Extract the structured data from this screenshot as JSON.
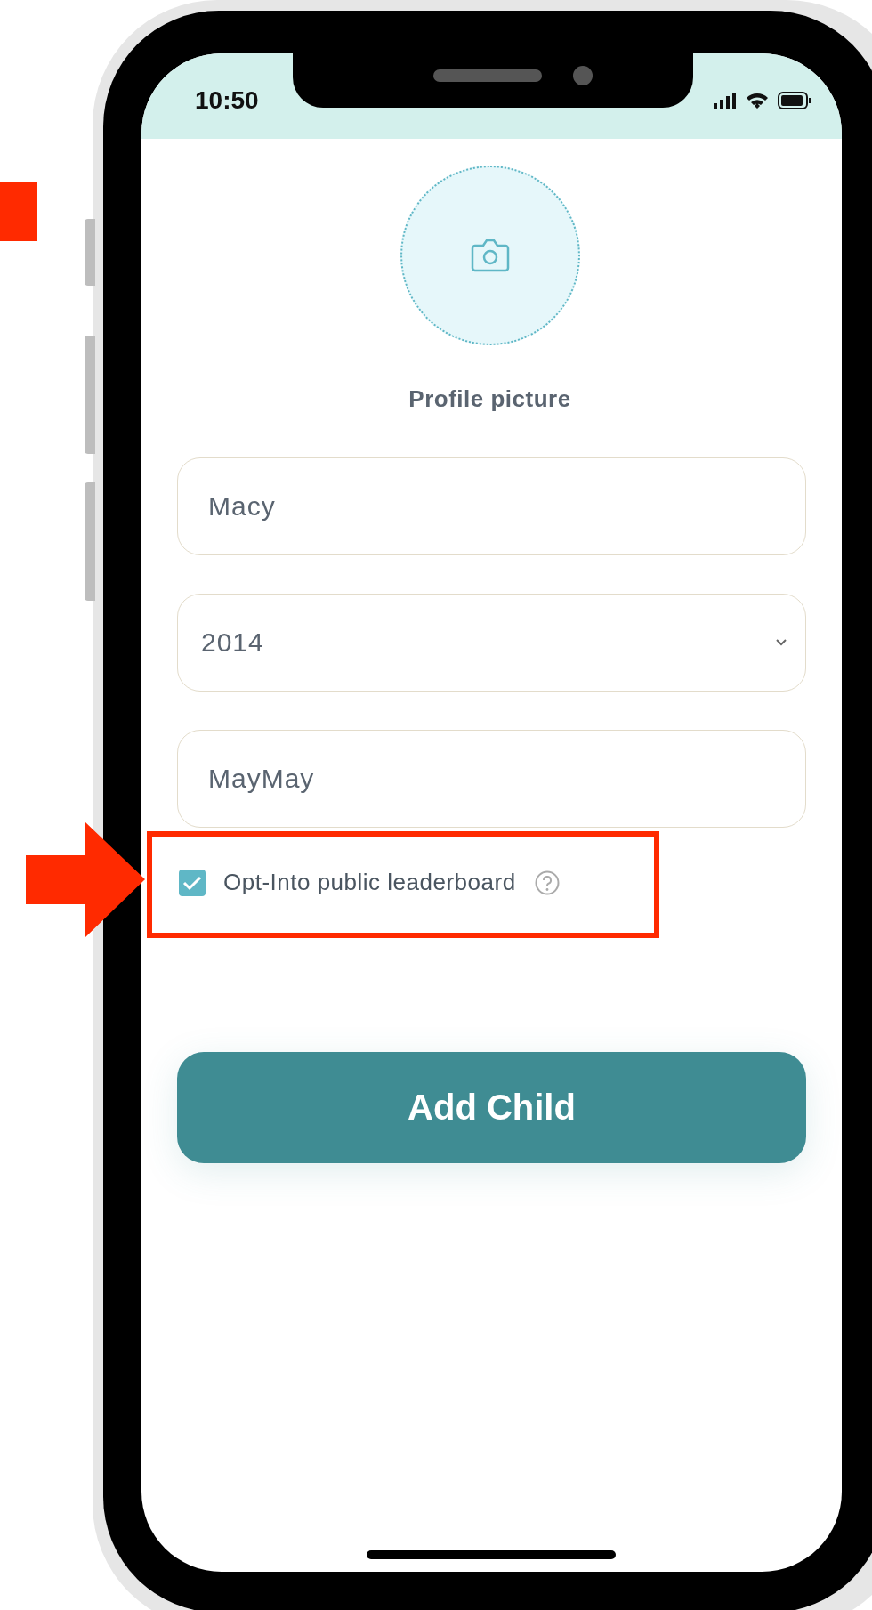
{
  "status_bar": {
    "time": "10:50"
  },
  "profile_picture": {
    "label": "Profile picture"
  },
  "fields": [
    {
      "kind": "text",
      "value": "Macy"
    },
    {
      "kind": "select",
      "value": "2014"
    },
    {
      "kind": "text",
      "value": "MayMay"
    }
  ],
  "leaderboard_option": {
    "label": "Opt-Into public leaderboard",
    "checked": true
  },
  "submit_button": {
    "label": "Add Child"
  }
}
